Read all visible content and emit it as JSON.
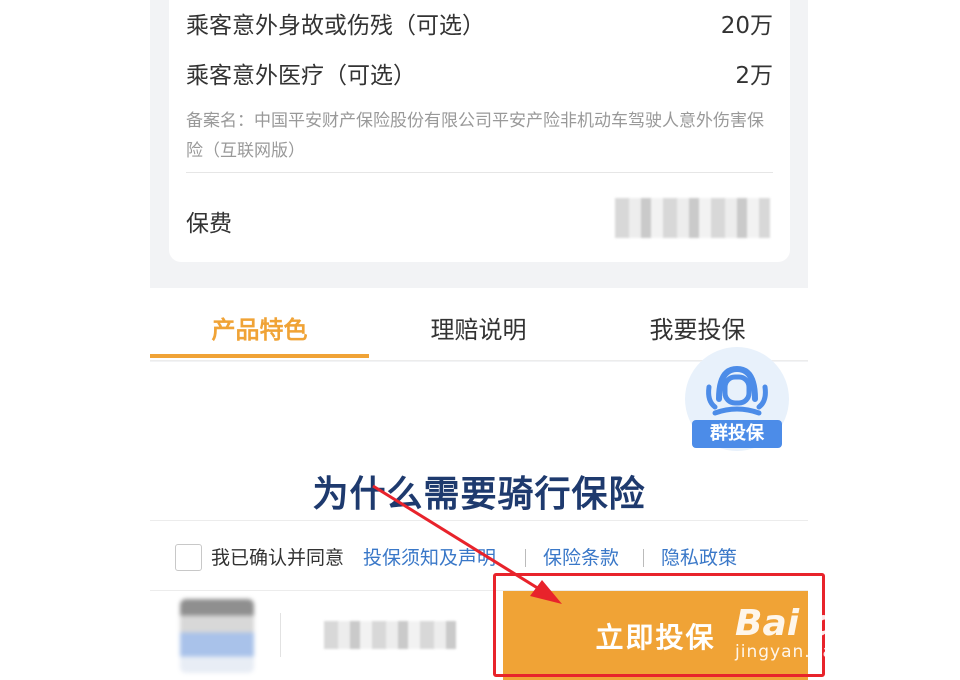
{
  "coverage": {
    "items": [
      {
        "label": "乘客意外身故或伤残（可选）",
        "value": "20万"
      },
      {
        "label": "乘客意外医疗（可选）",
        "value": "2万"
      }
    ],
    "filing_note": "备案名：中国平安财产保险股份有限公司平安产险非机动车驾驶人意外伤害保险（互联网版）",
    "premium_label": "保费"
  },
  "tabs": [
    {
      "label": "产品特色",
      "active": true
    },
    {
      "label": "理赔说明",
      "active": false
    },
    {
      "label": "我要投保",
      "active": false
    }
  ],
  "group_insure": {
    "label": "群投保",
    "icon": "headset-agent-icon"
  },
  "section_heading": "为什么需要骑行保险",
  "agreement": {
    "prefix": "我已确认并同意",
    "links": [
      "投保须知及声明",
      "保险条款",
      "隐私政策"
    ],
    "checked": false
  },
  "footer": {
    "cta_label": "立即投保"
  },
  "annotation": {
    "color": "#e8232b"
  },
  "watermark": {
    "logo": "Bai du 经验",
    "site": "jingyan.baidu.com"
  },
  "colors": {
    "accent": "#f0a336",
    "link": "#3a78c8",
    "heading": "#1e3a6e",
    "badge": "#4c8ce8"
  }
}
